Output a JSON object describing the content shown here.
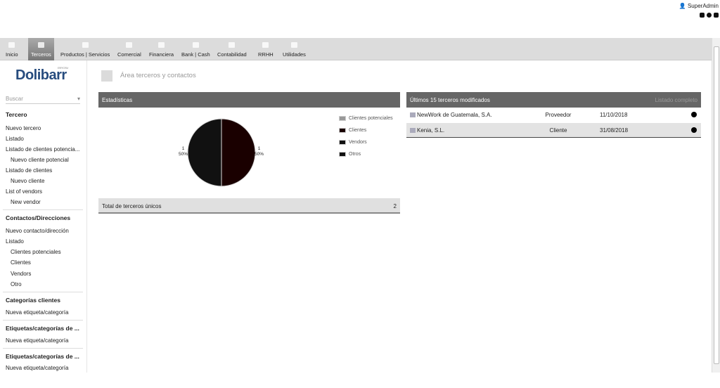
{
  "menu": [
    {
      "label": "Inicio"
    },
    {
      "label": "Terceros"
    },
    {
      "label": "Productos | Servicios"
    },
    {
      "label": "Comercial"
    },
    {
      "label": "Financiera"
    },
    {
      "label": "Bank | Cash"
    },
    {
      "label": "Contabilidad"
    },
    {
      "label": "RRHH"
    },
    {
      "label": "Utilidades"
    }
  ],
  "user": "SuperAdmin",
  "logo": {
    "text": "Dolibarr",
    "sub": "ERP/CRM"
  },
  "search_placeholder": "Buscar",
  "sidebar": [
    {
      "t": "Tercero",
      "k": "h"
    },
    {
      "t": "Nuevo tercero"
    },
    {
      "t": "Listado"
    },
    {
      "t": "Listado de clientes potencia..."
    },
    {
      "t": "Nuevo cliente potencial",
      "k": "sub"
    },
    {
      "t": "Listado de clientes"
    },
    {
      "t": "Nuevo cliente",
      "k": "sub"
    },
    {
      "t": "List of vendors"
    },
    {
      "t": "New vendor",
      "k": "sub"
    },
    {
      "t": "Contactos/Direcciones",
      "k": "h"
    },
    {
      "t": "Nuevo contacto/dirección"
    },
    {
      "t": "Listado"
    },
    {
      "t": "Clientes potenciales",
      "k": "sub"
    },
    {
      "t": "Clientes",
      "k": "sub"
    },
    {
      "t": "Vendors",
      "k": "sub"
    },
    {
      "t": "Otro",
      "k": "sub"
    },
    {
      "t": "Categorías clientes",
      "k": "h"
    },
    {
      "t": "Nueva etiqueta/categoría"
    },
    {
      "t": "Etiquetas/categorías de ...",
      "k": "h"
    },
    {
      "t": "Nueva etiqueta/categoría"
    },
    {
      "t": "Etiquetas/categorías de ...",
      "k": "h"
    },
    {
      "t": "Nueva etiqueta/categoría"
    }
  ],
  "page_title": "Área terceros y contactos",
  "stats": {
    "title": "Estadísticas",
    "total_label": "Total de terceros únicos",
    "total": "2"
  },
  "chart_data": {
    "type": "pie",
    "legend": [
      "Clientes potenciales",
      "Clientes",
      "Vendors",
      "Otros"
    ],
    "colors": [
      "#999999",
      "#1a0000",
      "#111111",
      "#111111"
    ],
    "slices": [
      {
        "name": "Vendors",
        "value": 1,
        "pct": "50%",
        "label": "1"
      },
      {
        "name": "Clientes",
        "value": 1,
        "pct": "50%",
        "label": "1"
      }
    ]
  },
  "last": {
    "title": "Últimos 15 terceros modificados",
    "link": "Listado completo",
    "rows": [
      {
        "name": "NewWork de Guatemala, S.A.",
        "type": "Proveedor",
        "date": "11/10/2018"
      },
      {
        "name": "Kenia, S.L.",
        "type": "Cliente",
        "date": "31/08/2018"
      }
    ]
  }
}
